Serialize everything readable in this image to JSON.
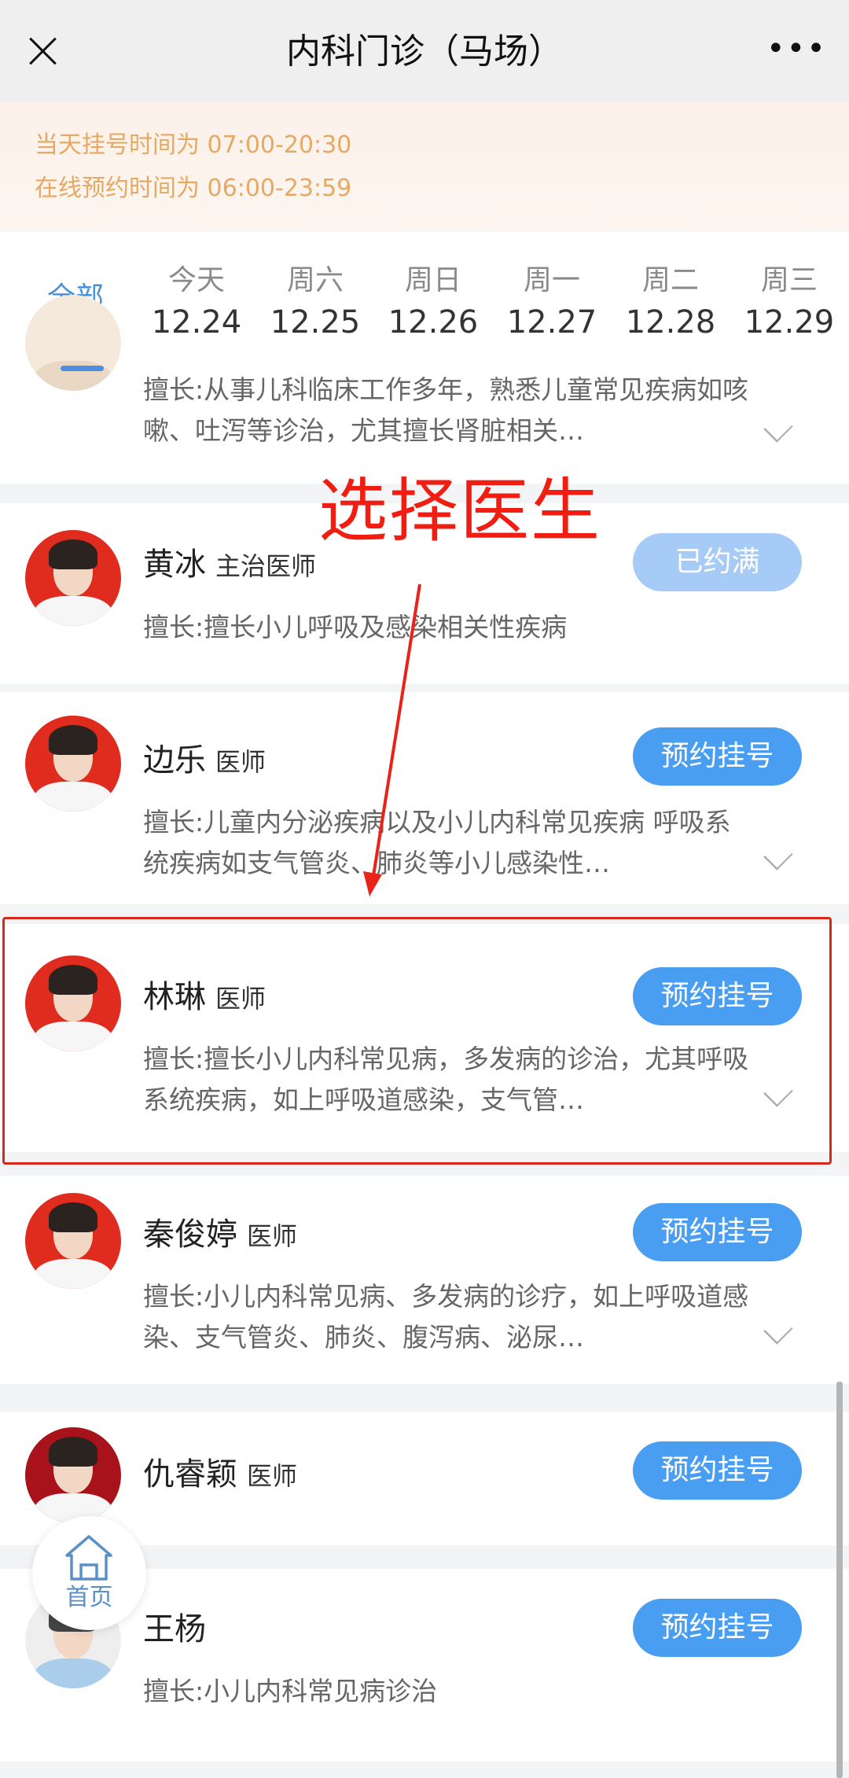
{
  "header": {
    "title": "内科门诊（马场）",
    "more_label": "•••",
    "close_icon": "close-icon",
    "more_icon": "more-dots-icon"
  },
  "notice": {
    "line1": "当天挂号时间为 07:00-20:30",
    "line2": "在线预约时间为 06:00-23:59"
  },
  "tabs": {
    "all_label": "全部",
    "active": "全部",
    "days": [
      {
        "weekday": "今天",
        "date": "12.24"
      },
      {
        "weekday": "周六",
        "date": "12.25"
      },
      {
        "weekday": "周日",
        "date": "12.26"
      },
      {
        "weekday": "周一",
        "date": "12.27"
      },
      {
        "weekday": "周二",
        "date": "12.28"
      },
      {
        "weekday": "周三",
        "date": "12.29"
      }
    ]
  },
  "doctors": [
    {
      "name": "",
      "rank": "",
      "desc": "擅长:从事儿科临床工作多年，熟悉儿童常见疾病如咳嗽、吐泻等诊治，尤其擅长肾脏相关…",
      "button": "",
      "expandable": true
    },
    {
      "name": "黄冰",
      "rank": "主治医师",
      "desc": "擅长:擅长小儿呼吸及感染相关性疾病",
      "button": "已约满",
      "status": "full"
    },
    {
      "name": "边乐",
      "rank": "医师",
      "desc": "擅长:儿童内分泌疾病以及小儿内科常见疾病 呼吸系统疾病如支气管炎、肺炎等小儿感染性…",
      "button": "预约挂号",
      "expandable": true
    },
    {
      "name": "林琳",
      "rank": "医师",
      "desc": "擅长:擅长小儿内科常见病，多发病的诊治，尤其呼吸系统疾病，如上呼吸道感染，支气管…",
      "button": "预约挂号",
      "expandable": true
    },
    {
      "name": "秦俊婷",
      "rank": "医师",
      "desc": "擅长:小儿内科常见病、多发病的诊疗，如上呼吸道感染、支气管炎、肺炎、腹泻病、泌尿…",
      "button": "预约挂号",
      "expandable": true
    },
    {
      "name": "仇睿颖",
      "rank": "医师",
      "desc": "",
      "button": "预约挂号"
    },
    {
      "name": "王杨",
      "rank": "",
      "desc": "擅长:小儿内科常见病诊治",
      "button": "预约挂号"
    }
  ],
  "annotation": {
    "label": "选择医生",
    "color": "#f01d12"
  },
  "home_fab": {
    "label": "首页",
    "icon": "home-icon"
  },
  "colors": {
    "primary_button": "#4a9ef2",
    "disabled_button": "#a7cbf7",
    "notice_text": "#e6a964",
    "active_tab": "#4a90d9"
  }
}
